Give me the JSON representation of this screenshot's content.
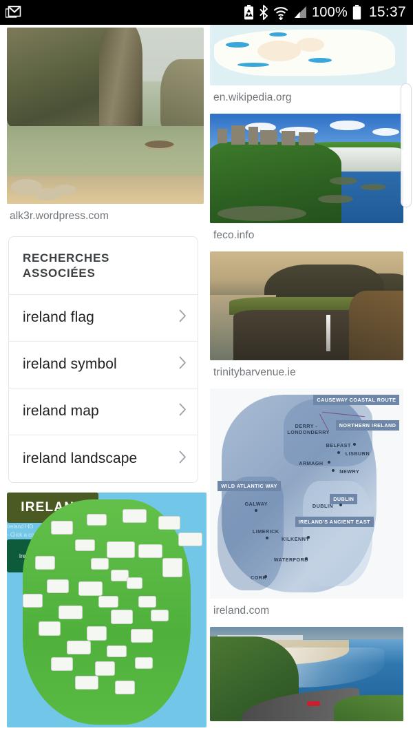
{
  "statusbar": {
    "notification_icon": "gmail-icon",
    "icons": [
      "battery-saver-icon",
      "bluetooth-icon",
      "wifi-icon",
      "cellular-signal-icon"
    ],
    "battery_percent": "100%",
    "battery_icon": "battery-full-icon",
    "clock": "15:37"
  },
  "left_column": {
    "tiles": [
      {
        "image": "karst-rock-bay-photo",
        "source": "alk3r.wordpress.com"
      },
      {
        "image": "ireland-tourist-cartoon-map",
        "source": ""
      }
    ],
    "cartoon_map": {
      "banner_title": "IRELAND",
      "subtitle_line1": "Ireland HD",
      "subtitle_line2": "- Click a county -",
      "badge": "Ireland IOL"
    }
  },
  "related_searches": {
    "heading": "RECHERCHES ASSOCIÉES",
    "chevron_icon": "chevron-right-icon",
    "items": [
      {
        "label": "ireland flag"
      },
      {
        "label": "ireland symbol"
      },
      {
        "label": "ireland map"
      },
      {
        "label": "ireland landscape"
      }
    ]
  },
  "right_column": {
    "tiles": [
      {
        "image": "wikipedia-coastline-map",
        "source": "en.wikipedia.org"
      },
      {
        "image": "dunluce-castle-cliffs-photo",
        "source": "feco.info"
      },
      {
        "image": "gasadalur-cliff-waterfall-photo",
        "source": "trinitybarvenue.ie"
      },
      {
        "image": "ireland-regions-tourism-map",
        "source": "ireland.com"
      },
      {
        "image": "coastal-road-beach-photo",
        "source": ""
      }
    ],
    "regions_map": {
      "region_tags": [
        "CAUSEWAY COASTAL ROUTE",
        "NORTHERN IRELAND",
        "WILD ATLANTIC WAY",
        "DUBLIN",
        "IRELAND'S ANCIENT EAST"
      ],
      "cities": [
        "DERRY -",
        "LONDONDERRY",
        "BELFAST",
        "LISBURN",
        "ARMAGH",
        "NEWRY",
        "GALWAY",
        "DUBLIN",
        "LIMERICK",
        "KILKENNY",
        "WATERFORD",
        "CORK"
      ]
    }
  },
  "scrollbar": {
    "name": "vertical-scrollbar"
  },
  "colors": {
    "statusbar_bg": "#000000",
    "page_bg": "#ffffff",
    "source_text": "#70757a",
    "card_border": "#e3e5e8",
    "heading_text": "#3c4043",
    "item_text": "#202124",
    "chevron": "#9aa0a6"
  }
}
